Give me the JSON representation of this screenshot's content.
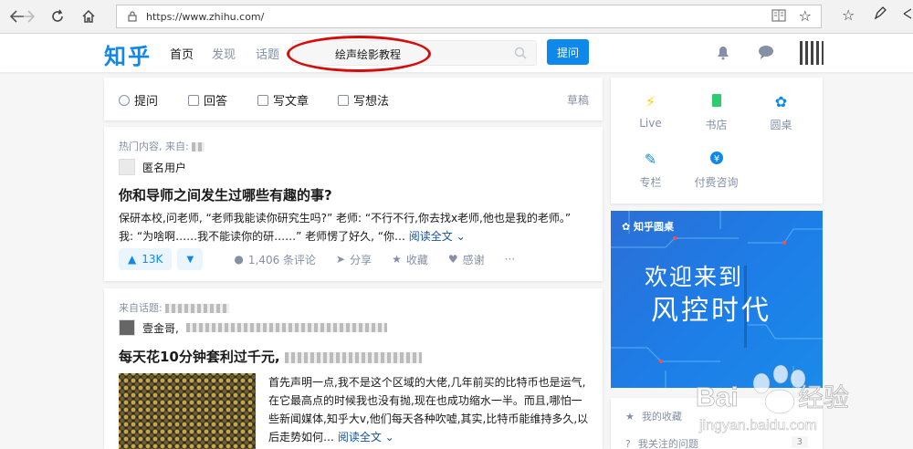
{
  "browser": {
    "url": "https://www.zhihu.com/",
    "icons": [
      "back-arrow-icon",
      "forward-arrow-icon",
      "refresh-icon",
      "home-icon",
      "lock-icon",
      "reader-view-icon",
      "favorite-star-icon",
      "favorites-list-icon",
      "pen-icon",
      "share-icon"
    ]
  },
  "header": {
    "logo": "知乎",
    "nav": [
      "首页",
      "发现",
      "话题"
    ],
    "search_value": "绘声绘影教程",
    "ask_label": "提问"
  },
  "actions": {
    "items": [
      "提问",
      "回答",
      "写文章",
      "写想法"
    ],
    "draft": "草稿"
  },
  "feed1": {
    "meta": "热门内容, 来自:",
    "author": "匿名用户",
    "title": "你和导师之间发生过哪些有趣的事?",
    "excerpt": "保研本校,问老师, “老师我能读你研究生吗?” 老师: “不行不行,你去找x老师,他也是我的老师。” 我: “为啥啊……我不能读你的研……” 老师愣了好久, “你…",
    "read_more": "阅读全文",
    "votes": "13K",
    "comments": "1,406 条评论",
    "share": "分享",
    "collect": "收藏",
    "thanks": "感谢",
    "more": "···"
  },
  "feed2": {
    "meta": "来自话题:",
    "author": "壹金哥,",
    "title": "每天花10分钟套利过千元,",
    "excerpt": "首先声明一点,我不是这个区域的大佬,几年前买的比特币也是运气,在它最高点的时候我也没有抛,现在也成功缩水一半。而且,哪怕一些新闻媒体,知乎大v,他们每天各种吹嘘,其实,比特币能维持多久,以后走势如何…",
    "read_more": "阅读全文"
  },
  "sidebar": {
    "grid": [
      "Live",
      "书店",
      "圆桌",
      "专栏",
      "付费咨询"
    ],
    "banner_brand": "知乎圆桌",
    "banner_line1": "欢迎来到",
    "banner_line2": "风控时代",
    "list": [
      {
        "label": "我的收藏",
        "count": ""
      },
      {
        "label": "我关注的问题",
        "count": "3"
      }
    ]
  },
  "watermark": {
    "brand": "Baidu 经验",
    "domain": "jingyan.baidu.com"
  },
  "colors": {
    "brand_blue": "#0f88eb",
    "annotation_red": "#d50c0c",
    "muted_text": "#8590a6"
  }
}
